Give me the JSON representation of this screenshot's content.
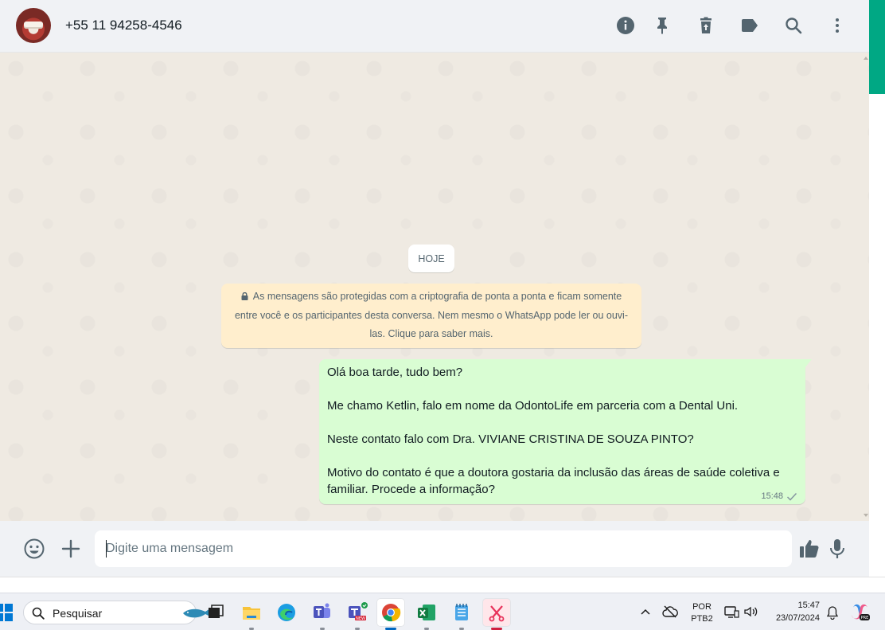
{
  "header": {
    "contact_name": "+55 11 94258-4546",
    "icons": [
      "info-icon",
      "pin-icon",
      "delete-icon",
      "label-icon",
      "search-icon",
      "menu-icon"
    ]
  },
  "conversation": {
    "date_label": "HOJE",
    "encryption_notice": "As mensagens são protegidas com a criptografia de ponta a ponta e ficam somente entre você e os participantes desta conversa. Nem mesmo o WhatsApp pode ler ou ouvi-las. Clique para saber mais.",
    "message": {
      "lines": [
        "Olá boa tarde, tudo bem?",
        "Me chamo Ketlin, falo em nome da OdontoLife em parceria com a Dental Uni.",
        "Neste contato falo com Dra. VIVIANE CRISTINA DE SOUZA PINTO?",
        "Motivo do contato é que a doutora gostaria da inclusão das áreas de saúde coletiva e",
        "familiar. Procede a informação?"
      ],
      "time": "15:48",
      "status": "sent"
    }
  },
  "composer": {
    "placeholder": "Digite uma mensagem"
  },
  "taskbar": {
    "search_label": "Pesquisar",
    "apps": [
      "file-explorer",
      "edge",
      "teams",
      "teams-new",
      "chrome",
      "excel",
      "notepad",
      "snipping-tool"
    ],
    "lang_code": "POR",
    "lang_layout": "PTB2",
    "time": "15:47",
    "date": "23/07/2024",
    "badge_new": "NEW",
    "badge_pre": "PRE"
  },
  "colors": {
    "accent": "#00a884",
    "bubble_out": "#d9fdd3",
    "notice_bg": "#ffeecd",
    "chat_bg": "#efeae2",
    "panel_bg": "#f0f2f5"
  }
}
